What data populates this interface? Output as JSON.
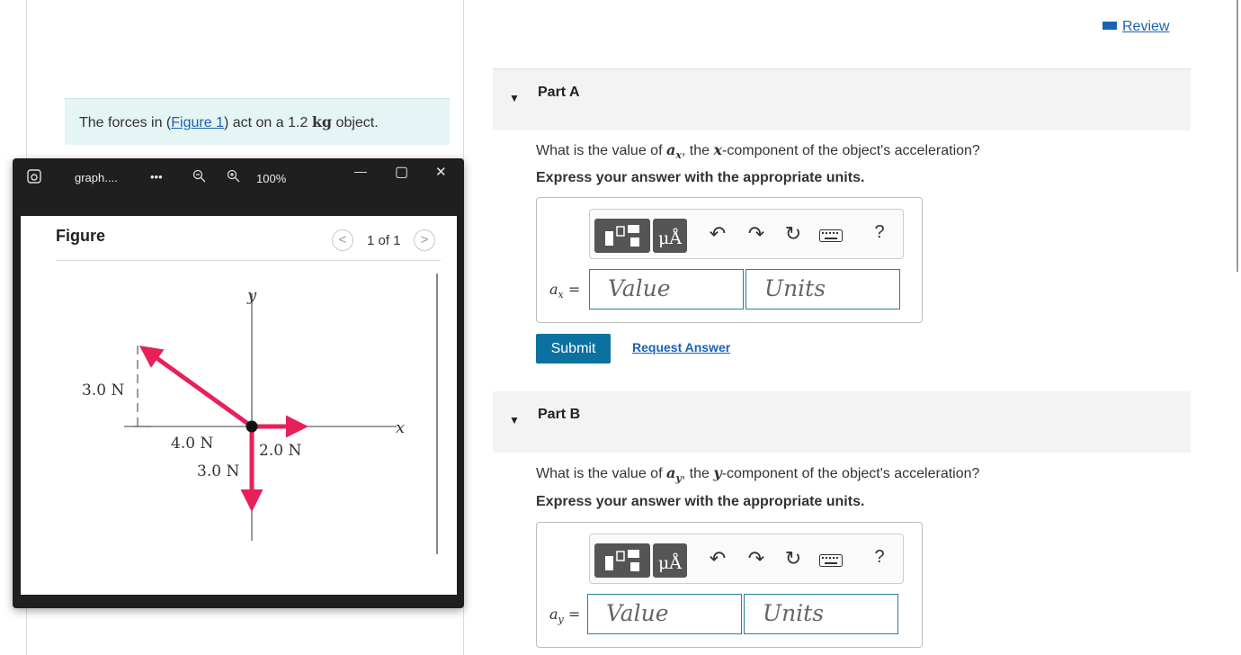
{
  "intro": {
    "prefix": "The forces in (",
    "figure_link": "Figure 1",
    "middle": ") act on a 1.2 ",
    "unit": "kg",
    "suffix": " object."
  },
  "viewer": {
    "filename": "graph....",
    "more": "•••",
    "zoom": "100%",
    "minimize": "—",
    "maximize": "▢",
    "close": "✕",
    "figure_title": "Figure",
    "pager_prev": "<",
    "pager_text": "1 of 1",
    "pager_next": ">"
  },
  "figure": {
    "y_label": "y",
    "x_label": "x",
    "force_up_left": "4.0 N",
    "force_right": "2.0 N",
    "force_down": "3.0 N",
    "dim_vertical": "3.0 N",
    "arrow_color": "#e8205a"
  },
  "review": {
    "label": "Review"
  },
  "parts": [
    {
      "title": "Part A",
      "question_prefix": "What is the value of ",
      "question_var": "a",
      "question_sub": "x",
      "question_mid": ", the ",
      "question_axis": "x",
      "question_suffix": "-component of the object's acceleration?",
      "instruction": "Express your answer with the appropriate units.",
      "answer_var": "a",
      "answer_sub": "x",
      "value_placeholder": "Value",
      "units_placeholder": "Units",
      "submit": "Submit",
      "request": "Request Answer"
    },
    {
      "title": "Part B",
      "question_prefix": "What is the value of ",
      "question_var": "a",
      "question_sub": "y",
      "question_mid": ", the ",
      "question_axis": "y",
      "question_suffix": "-component of the object's acceleration?",
      "instruction": "Express your answer with the appropriate units.",
      "answer_var": "a",
      "answer_sub": "y",
      "value_placeholder": "Value",
      "units_placeholder": "Units"
    }
  ],
  "toolbar": {
    "templates_icon": "templates-icon",
    "units_symbol": "μÅ",
    "undo": "↶",
    "redo": "↷",
    "reset": "↻",
    "keyboard_icon": "keyboard-icon",
    "help": "?"
  }
}
